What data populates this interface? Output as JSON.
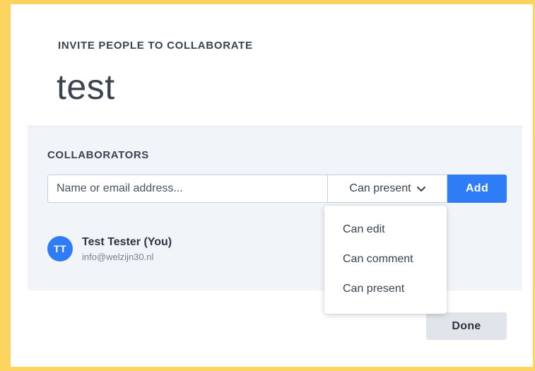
{
  "dialog": {
    "eyebrow": "INVITE PEOPLE TO COLLABORATE",
    "title": "test"
  },
  "collaborators": {
    "section_label": "COLLABORATORS",
    "input_placeholder": "Name or email address...",
    "input_value": "",
    "permission_selected": "Can present",
    "add_label": "Add",
    "list": [
      {
        "initials": "TT",
        "name": "Test Tester (You)",
        "email": "info@welzijn30.nl"
      }
    ]
  },
  "permission_menu": {
    "options": [
      "Can edit",
      "Can comment",
      "Can present"
    ]
  },
  "footer": {
    "done_label": "Done"
  },
  "colors": {
    "frame": "#fcd45f",
    "accent": "#2f7df6",
    "panel": "#f1f4f8"
  }
}
